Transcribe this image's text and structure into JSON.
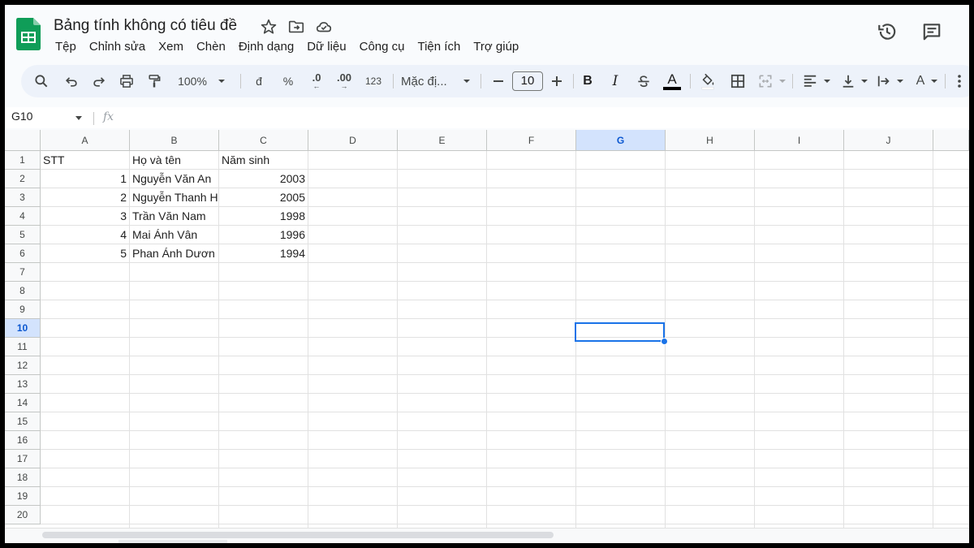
{
  "app": {
    "title": "Bảng tính không có tiêu đề",
    "menu": [
      "Tệp",
      "Chỉnh sửa",
      "Xem",
      "Chèn",
      "Định dạng",
      "Dữ liệu",
      "Công cụ",
      "Tiện ích",
      "Trợ giúp"
    ]
  },
  "toolbar": {
    "zoom": "100%",
    "currency": "đ",
    "percent": "%",
    "decrease_decimal": ".0",
    "increase_decimal": ".00",
    "number_format": "123",
    "font": "Mặc đị...",
    "font_size": "10",
    "bold": "B",
    "italic": "I",
    "text_color": "A",
    "text_rotation": "A"
  },
  "formula_bar": {
    "name_box": "G10",
    "fx": "fx"
  },
  "sheet": {
    "columns": [
      "A",
      "B",
      "C",
      "D",
      "E",
      "F",
      "G",
      "H",
      "I",
      "J"
    ],
    "rows": [
      "1",
      "2",
      "3",
      "4",
      "5",
      "6",
      "7",
      "8",
      "9",
      "10",
      "11",
      "12",
      "13",
      "14",
      "15",
      "16",
      "17",
      "18",
      "19",
      "20"
    ],
    "selected_column": "G",
    "selected_row": "10",
    "headers": {
      "a1": "STT",
      "b1": "Họ và tên",
      "c1": "Năm sinh"
    },
    "data": [
      {
        "stt": "1",
        "name": "Nguyễn Văn An",
        "year": "2003"
      },
      {
        "stt": "2",
        "name": "Nguyễn Thanh H",
        "year": "2005"
      },
      {
        "stt": "3",
        "name": "Trần Văn Nam",
        "year": "1998"
      },
      {
        "stt": "4",
        "name": "Mai Ánh Vân",
        "year": "1996"
      },
      {
        "stt": "5",
        "name": "Phan Ánh Dươn",
        "year": "1994"
      }
    ]
  },
  "colors": {
    "selection": "#1a73e8",
    "header_selected_bg": "#d3e3fd",
    "sheets_green": "#0f9d58"
  },
  "icons": [
    "sheets-logo-icon",
    "star-icon",
    "move-folder-icon",
    "cloud-saved-icon",
    "version-history-icon",
    "comments-icon",
    "search-menu-icon",
    "undo-icon",
    "redo-icon",
    "print-icon",
    "paint-format-icon",
    "strikethrough-icon",
    "fill-color-icon",
    "borders-icon",
    "merge-cells-icon",
    "align-left-icon",
    "vertical-align-icon",
    "text-wrap-icon",
    "more-vert-icon"
  ]
}
